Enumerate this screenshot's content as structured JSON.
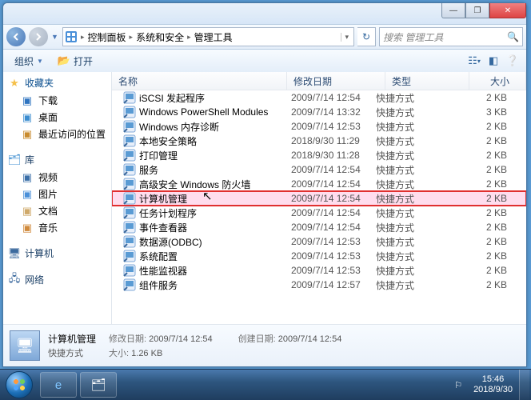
{
  "window_controls": {
    "minimize": "—",
    "maximize": "❐",
    "close": "✕"
  },
  "breadcrumb": {
    "icon_label": "控制面板",
    "items": [
      "控制面板",
      "系统和安全",
      "管理工具"
    ]
  },
  "search": {
    "placeholder": "搜索 管理工具"
  },
  "toolbar": {
    "organize": "组织",
    "open": "打开"
  },
  "sidebar": {
    "favorites": {
      "label": "收藏夹",
      "items": [
        {
          "icon": "download-icon",
          "label": "下载",
          "color": "#2f74c0"
        },
        {
          "icon": "desktop-icon",
          "label": "桌面",
          "color": "#3c8dd0"
        },
        {
          "icon": "recent-icon",
          "label": "最近访问的位置",
          "color": "#c98b2e"
        }
      ]
    },
    "libraries": {
      "label": "库",
      "items": [
        {
          "icon": "video-icon",
          "label": "视频",
          "color": "#3b6fa8"
        },
        {
          "icon": "pictures-icon",
          "label": "图片",
          "color": "#4a90d9"
        },
        {
          "icon": "documents-icon",
          "label": "文档",
          "color": "#cfa96a"
        },
        {
          "icon": "music-icon",
          "label": "音乐",
          "color": "#d08a3c"
        }
      ]
    },
    "computer": {
      "label": "计算机"
    },
    "network": {
      "label": "网络"
    }
  },
  "columns": {
    "name": "名称",
    "date": "修改日期",
    "type": "类型",
    "size": "大小"
  },
  "files": [
    {
      "name": "iSCSI 发起程序",
      "date": "2009/7/14 12:54",
      "type": "快捷方式",
      "size": "2 KB"
    },
    {
      "name": "Windows PowerShell Modules",
      "date": "2009/7/14 13:32",
      "type": "快捷方式",
      "size": "3 KB"
    },
    {
      "name": "Windows 内存诊断",
      "date": "2009/7/14 12:53",
      "type": "快捷方式",
      "size": "2 KB"
    },
    {
      "name": "本地安全策略",
      "date": "2018/9/30 11:29",
      "type": "快捷方式",
      "size": "2 KB"
    },
    {
      "name": "打印管理",
      "date": "2018/9/30 11:28",
      "type": "快捷方式",
      "size": "2 KB"
    },
    {
      "name": "服务",
      "date": "2009/7/14 12:54",
      "type": "快捷方式",
      "size": "2 KB"
    },
    {
      "name": "高级安全 Windows 防火墙",
      "date": "2009/7/14 12:54",
      "type": "快捷方式",
      "size": "2 KB"
    },
    {
      "name": "计算机管理",
      "date": "2009/7/14 12:54",
      "type": "快捷方式",
      "size": "2 KB",
      "highlight": true
    },
    {
      "name": "任务计划程序",
      "date": "2009/7/14 12:54",
      "type": "快捷方式",
      "size": "2 KB"
    },
    {
      "name": "事件查看器",
      "date": "2009/7/14 12:54",
      "type": "快捷方式",
      "size": "2 KB"
    },
    {
      "name": "数据源(ODBC)",
      "date": "2009/7/14 12:53",
      "type": "快捷方式",
      "size": "2 KB"
    },
    {
      "name": "系统配置",
      "date": "2009/7/14 12:53",
      "type": "快捷方式",
      "size": "2 KB"
    },
    {
      "name": "性能监视器",
      "date": "2009/7/14 12:53",
      "type": "快捷方式",
      "size": "2 KB"
    },
    {
      "name": "组件服务",
      "date": "2009/7/14 12:57",
      "type": "快捷方式",
      "size": "2 KB"
    }
  ],
  "details": {
    "name": "计算机管理",
    "line2": "快捷方式",
    "mod_label": "修改日期:",
    "mod_value": "2009/7/14 12:54",
    "size_label": "大小:",
    "size_value": "1.26 KB",
    "created_label": "创建日期:",
    "created_value": "2009/7/14 12:54"
  },
  "taskbar": {
    "time": "15:46",
    "date": "2018/9/30"
  }
}
